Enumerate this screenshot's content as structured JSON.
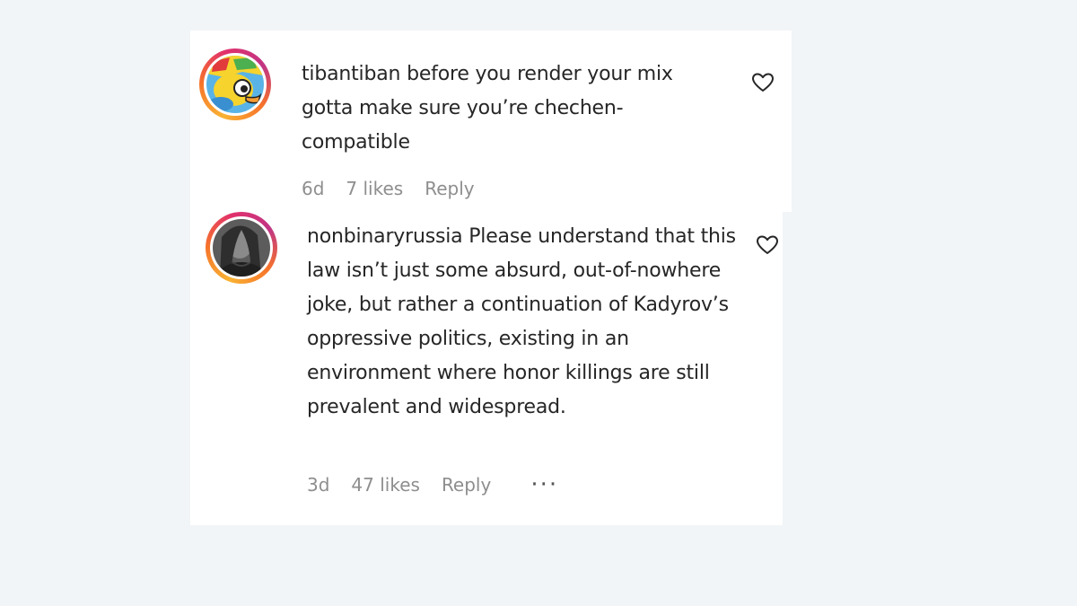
{
  "comments": [
    {
      "username": "tibantiban",
      "text": "before you render your mix gotta make sure you’re chechen-compatible",
      "time": "6d",
      "likes": "7 likes",
      "reply_label": "Reply",
      "avatar_icon": "cartoon-character-avatar-icon"
    },
    {
      "username": "nonbinaryrussia",
      "text": "Please understand that this law isn’t just some absurd, out-of-nowhere joke, but rather a continuation of Kadyrov’s oppressive politics, existing in an environment where honor killings are still prevalent and widespread.",
      "time": "3d",
      "likes": "47 likes",
      "reply_label": "Reply",
      "more_label": "···",
      "avatar_icon": "profile-photo-avatar-icon"
    }
  ],
  "colors": {
    "background": "#f2f5f7",
    "card": "#ffffff",
    "text": "#262626",
    "muted": "#8e8e8e",
    "story_ring": [
      "#f9b233",
      "#e1306c",
      "#c13584"
    ]
  }
}
